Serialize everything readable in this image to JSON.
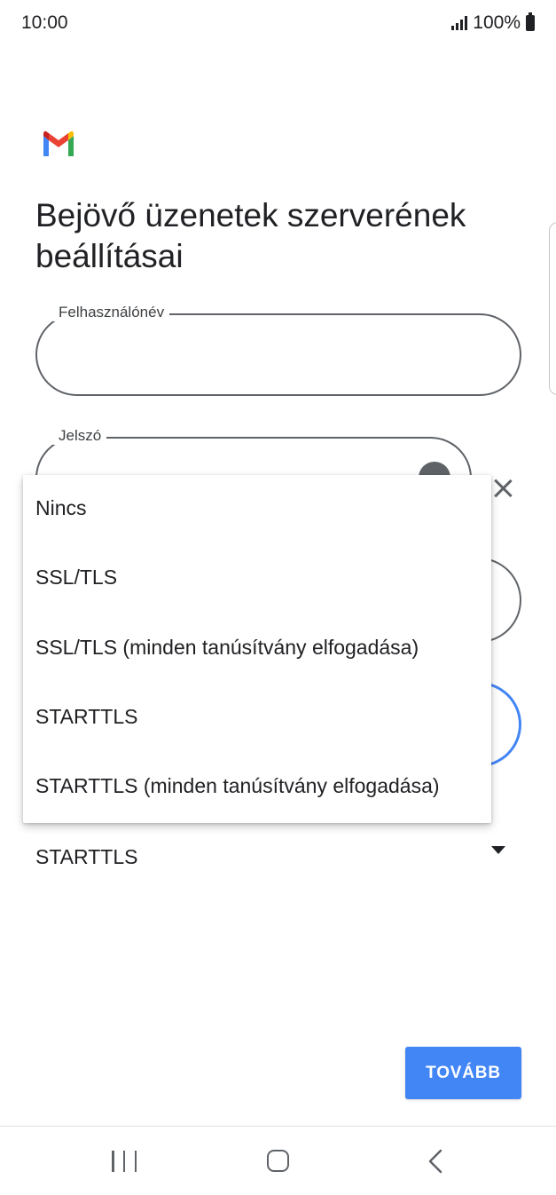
{
  "status_bar": {
    "time": "10:00",
    "battery": "100%"
  },
  "page": {
    "title": "Bejövő üzenetek szerverének beállításai"
  },
  "fields": {
    "username": {
      "label": "Felhasználónév",
      "value": ""
    },
    "password": {
      "label": "Jelszó",
      "value": ""
    }
  },
  "security": {
    "selected": "STARTTLS",
    "options": [
      "Nincs",
      "SSL/TLS",
      "SSL/TLS (minden tanúsítvány elfogadása)",
      "STARTTLS",
      "STARTTLS (minden tanúsítvány elfogadása)"
    ]
  },
  "actions": {
    "next_label": "TOVÁBB"
  },
  "icons": {
    "logo": "gmail-logo",
    "password_toggle": "eye-icon",
    "close": "close-icon",
    "dropdown": "dropdown-arrow-icon",
    "nav": [
      "recents-icon",
      "home-icon",
      "back-icon"
    ]
  },
  "colors": {
    "accent": "#4285f4",
    "text": "#202124",
    "outline": "#5f6368"
  }
}
